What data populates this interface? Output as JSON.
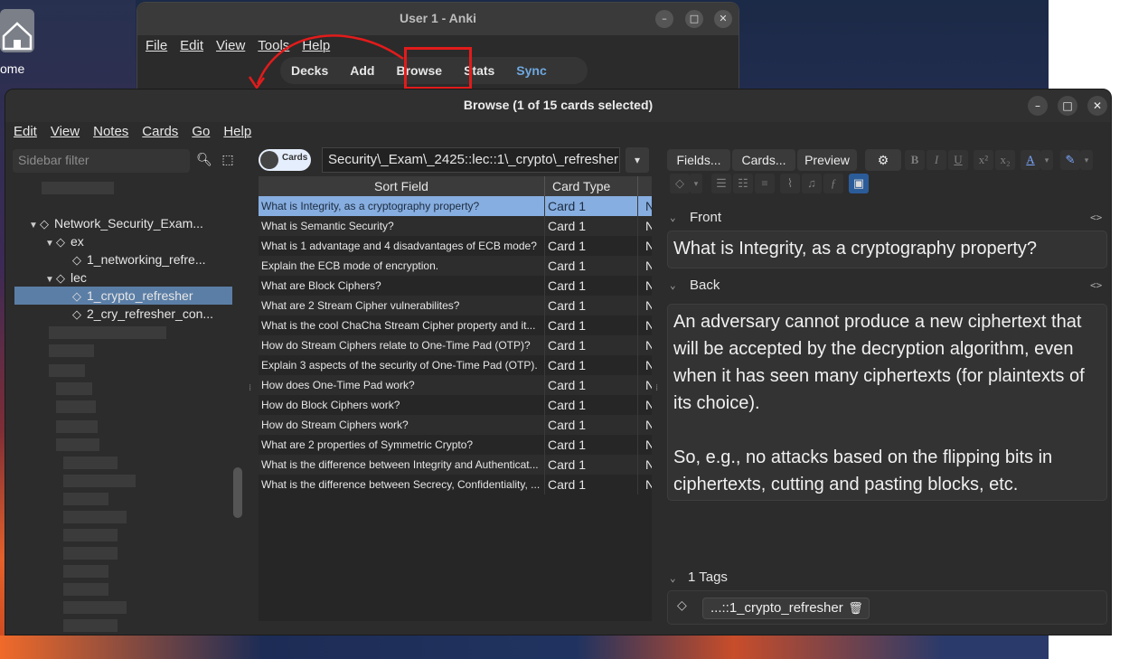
{
  "desktop": {
    "icon_label": "ome"
  },
  "main_window": {
    "title": "User 1 - Anki",
    "menu": [
      "File",
      "Edit",
      "View",
      "Tools",
      "Help"
    ],
    "toolbar": [
      "Decks",
      "Add",
      "Browse",
      "Stats",
      "Sync"
    ]
  },
  "browse": {
    "title": "Browse (1 of 15 cards selected)",
    "menu": [
      "Edit",
      "View",
      "Notes",
      "Cards",
      "Go",
      "Help"
    ],
    "sidebar": {
      "filter_placeholder": "Sidebar filter",
      "items": [
        {
          "label": "Network_Security_Exam..."
        },
        {
          "label": "ex"
        },
        {
          "label": "1_networking_refre..."
        },
        {
          "label": "lec"
        },
        {
          "label": "1_crypto_refresher"
        },
        {
          "label": "2_cry_refresher_con..."
        }
      ]
    },
    "toggle_label": "Cards",
    "search_text": "Security\\_Exam\\_2425::lec::1\\_crypto\\_refresher",
    "columns": [
      "Sort Field",
      "Card Type"
    ],
    "rows": [
      {
        "sort": "What is Integrity, as a cryptography property?",
        "type": "Card 1",
        "extra": "N"
      },
      {
        "sort": "What is Semantic Security?",
        "type": "Card 1",
        "extra": "N"
      },
      {
        "sort": "What is 1 advantage and 4 disadvantages of ECB mode?",
        "type": "Card 1",
        "extra": "N"
      },
      {
        "sort": "Explain the ECB mode of encryption.",
        "type": "Card 1",
        "extra": "N"
      },
      {
        "sort": "What are Block Ciphers?",
        "type": "Card 1",
        "extra": "N"
      },
      {
        "sort": "What are 2 Stream Cipher vulnerabilites?",
        "type": "Card 1",
        "extra": "N"
      },
      {
        "sort": "What is the cool ChaCha Stream Cipher property and it...",
        "type": "Card 1",
        "extra": "N"
      },
      {
        "sort": "How do Stream Ciphers relate to One-Time Pad (OTP)?",
        "type": "Card 1",
        "extra": "N"
      },
      {
        "sort": "Explain 3 aspects of the security of One-Time Pad (OTP).",
        "type": "Card 1",
        "extra": "N"
      },
      {
        "sort": "How does One-Time Pad work?",
        "type": "Card 1",
        "extra": "N"
      },
      {
        "sort": "How do Block Ciphers work?",
        "type": "Card 1",
        "extra": "N"
      },
      {
        "sort": "How do Stream Ciphers work?",
        "type": "Card 1",
        "extra": "N"
      },
      {
        "sort": "What are 2 properties of Symmetric Crypto?",
        "type": "Card 1",
        "extra": "N"
      },
      {
        "sort": "What is the difference between Integrity and Authenticat...",
        "type": "Card 1",
        "extra": "N"
      },
      {
        "sort": "What is the difference between Secrecy, Confidentiality, ...",
        "type": "Card 1",
        "extra": "N"
      }
    ],
    "editor": {
      "buttons": [
        "Fields...",
        "Cards...",
        "Preview"
      ],
      "format_buttons": [
        "B",
        "I",
        "U",
        "x²",
        "x₂",
        "A"
      ],
      "front_label": "Front",
      "front_value": "What is Integrity, as a cryptography property?",
      "back_label": "Back",
      "back_value_1": "An adversary cannot produce a new ciphertext that will be accepted by the decryption algorithm, even when it has seen many ciphertexts (for plaintexts of its choice).",
      "back_value_2": "So, e.g., no attacks based on the flipping bits in ciphertexts, cutting and pasting blocks, etc.",
      "tags_label": "1 Tags",
      "tag": "...::1_crypto_refresher"
    }
  },
  "colors": {
    "selection": "#87aee0",
    "sidebar_selection": "#5b7ea6",
    "annotation": "#e21b1b",
    "sync": "#6fa8e0"
  }
}
